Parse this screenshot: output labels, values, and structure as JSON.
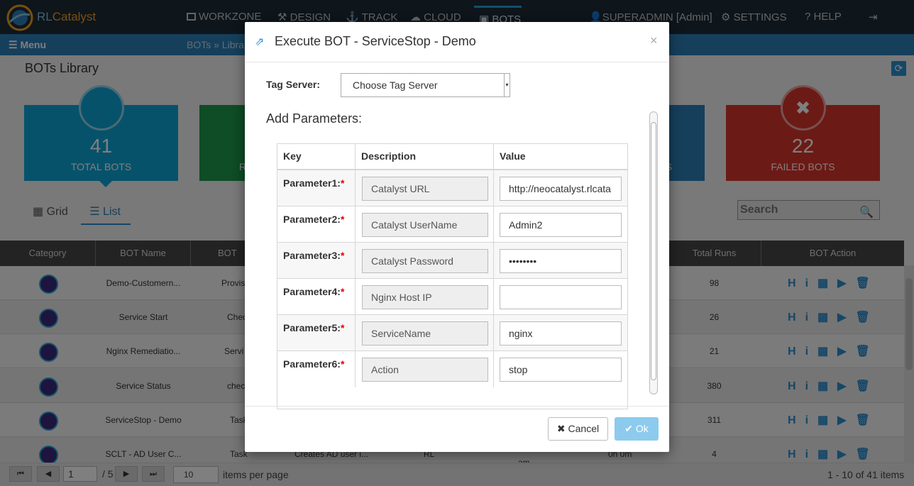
{
  "app": {
    "logo_text_a": "RL",
    "logo_text_b": "Catalyst"
  },
  "nav": [
    {
      "label": "WORKZONE",
      "icon": "monitor-icon"
    },
    {
      "label": "DESIGN",
      "icon": "sitemap-icon"
    },
    {
      "label": "TRACK",
      "icon": "anchor-icon"
    },
    {
      "label": "CLOUD",
      "icon": "cloud-icon"
    },
    {
      "label": "BOTS",
      "icon": "bots-icon"
    }
  ],
  "user": {
    "label": "SUPERADMIN [Admin]"
  },
  "settings_label": "SETTINGS",
  "help_label": "HELP",
  "subbar": {
    "menu_label": "Menu",
    "breadcrumb": "BOTs » Libra"
  },
  "page": {
    "title": "BOTs Library"
  },
  "cards": [
    {
      "number": "41",
      "label": "TOTAL BOTS",
      "color": "#0fa5d6"
    },
    {
      "number": "",
      "label": "R",
      "color": "#1c9a4a"
    },
    {
      "number": "",
      "label": "S",
      "color": "#2d7fb8"
    },
    {
      "number": "22",
      "label": "FAILED BOTS",
      "color": "#d9342b"
    }
  ],
  "view_tabs": {
    "grid": "Grid",
    "list": "List"
  },
  "search": {
    "placeholder": "Search"
  },
  "table": {
    "columns": [
      "Category",
      "BOT Name",
      "BOT Ty",
      "Total Runs",
      "BOT Action"
    ],
    "rows": [
      {
        "name": "Demo-Customern...",
        "type": "Provis",
        "runs": "98"
      },
      {
        "name": "Service Start",
        "type": "Chec",
        "runs": "26"
      },
      {
        "name": "Nginx Remediatio...",
        "type": "Servi",
        "runs": "21"
      },
      {
        "name": "Service Status",
        "type": "chec",
        "runs": "380"
      },
      {
        "name": "ServiceStop - Demo",
        "type": "Task",
        "runs": "311"
      },
      {
        "name": "SCLT - AD User C...",
        "type": "Task",
        "desc": "Creates AD user i...",
        "org": "RL",
        "time": "am",
        "dur": "0h 0m",
        "runs": "4"
      }
    ]
  },
  "pager": {
    "page": "1",
    "of": "/ 5",
    "per_page": "10",
    "per_page_label": "items per page",
    "summary": "1 - 10 of 41 items"
  },
  "modal": {
    "title": "Execute BOT - ServiceStop - Demo",
    "tag_server_label": "Tag Server:",
    "tag_server_value": "Choose Tag Server",
    "add_params_label": "Add Parameters:",
    "columns": [
      "Key",
      "Description",
      "Value"
    ],
    "params": [
      {
        "key": "Parameter1:",
        "desc": "Catalyst URL",
        "value": "http://neocatalyst.rlcata"
      },
      {
        "key": "Parameter2:",
        "desc": "Catalyst UserName",
        "value": "Admin2"
      },
      {
        "key": "Parameter3:",
        "desc": "Catalyst Password",
        "value": "••••••••"
      },
      {
        "key": "Parameter4:",
        "desc": "Nginx Host IP",
        "value": ""
      },
      {
        "key": "Parameter5:",
        "desc": "ServiceName",
        "value": "nginx"
      },
      {
        "key": "Parameter6:",
        "desc": "Action",
        "value": "stop"
      }
    ],
    "required_mark": "*",
    "cancel_label": "Cancel",
    "ok_label": "Ok"
  }
}
